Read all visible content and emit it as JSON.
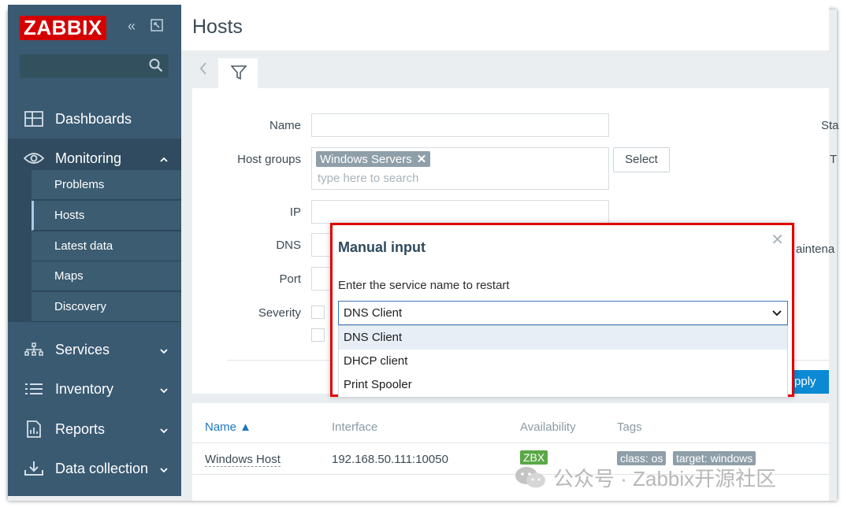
{
  "brand": {
    "logo_text": "ZABBIX"
  },
  "sidebar": {
    "nav": [
      {
        "label": "Dashboards",
        "icon": "dashboard-icon"
      },
      {
        "label": "Monitoring",
        "icon": "eye-icon"
      },
      {
        "label": "Services",
        "icon": "services-icon"
      },
      {
        "label": "Inventory",
        "icon": "list-icon"
      },
      {
        "label": "Reports",
        "icon": "report-icon"
      },
      {
        "label": "Data collection",
        "icon": "download-icon"
      }
    ],
    "monitoring_sub": [
      "Problems",
      "Hosts",
      "Latest data",
      "Maps",
      "Discovery"
    ]
  },
  "page": {
    "title": "Hosts"
  },
  "filter": {
    "name_label": "Name",
    "host_groups_label": "Host groups",
    "host_group_chip": "Windows Servers",
    "host_groups_placeholder": "type here to search",
    "select_button": "Select",
    "ip_label": "IP",
    "dns_label": "DNS",
    "port_label": "Port",
    "severity_label": "Severity",
    "status_clip": "Sta",
    "tags_clip": "T",
    "maintenance_clip": "aintena",
    "apply_button": "Apply"
  },
  "table": {
    "headers": {
      "name": "Name ▲",
      "interface": "Interface",
      "availability": "Availability",
      "tags": "Tags"
    },
    "rows": [
      {
        "name": "Windows Host",
        "interface": "192.168.50.111:10050",
        "availability": "ZBX",
        "tags": [
          "class: os",
          "target: windows"
        ]
      }
    ]
  },
  "modal": {
    "title": "Manual input",
    "label": "Enter the service name to restart",
    "selected": "DNS Client",
    "options": [
      "DNS Client",
      "DHCP client",
      "Print Spooler"
    ]
  },
  "watermark": {
    "text": "公众号 · Zabbix开源社区"
  },
  "colors": {
    "sidebar": "#3a5a72",
    "accent": "#0b89d3",
    "highlight_border": "#e00000",
    "zbx_green": "#5aa845",
    "logo_red": "#d40000"
  }
}
